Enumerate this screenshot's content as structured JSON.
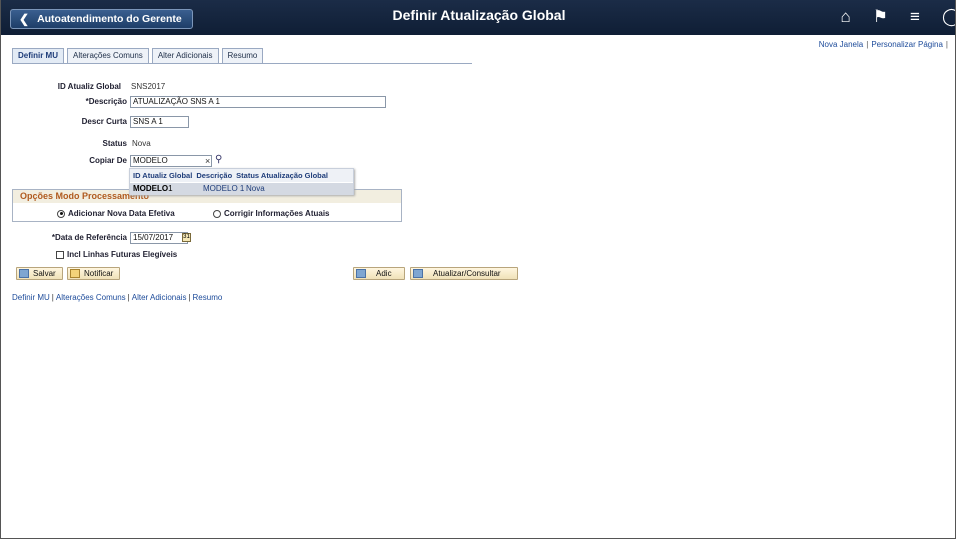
{
  "header": {
    "back_label": "Autoatendimento do Gerente",
    "title": "Definir Atualização Global",
    "icons": [
      "home-icon",
      "flag-icon",
      "menu-icon",
      "navbar-icon"
    ]
  },
  "toplinks": {
    "new_window": "Nova Janela",
    "personalize": "Personalizar Página"
  },
  "tabs": [
    "Definir MU",
    "Alterações Comuns",
    "Alter Adicionais",
    "Resumo"
  ],
  "form": {
    "id_label": "ID Atualiz Global",
    "id_value": "SNS2017",
    "descr_label": "*Descrição",
    "descr_value": "ATUALIZAÇÃO SNS A 1",
    "short_label": "Descr Curta",
    "short_value": "SNS A 1",
    "status_label": "Status",
    "status_value": "Nova",
    "copy_label": "Copiar De",
    "copy_value": "MODELO"
  },
  "dropdown": {
    "headers": [
      "ID Atualiz Global",
      "Descrição",
      "Status Atualização Global"
    ],
    "row": {
      "id": "MODELO1",
      "id_bold": "MODELO",
      "id_rest": "1",
      "descr": "MODELO 1",
      "status": "Nova"
    }
  },
  "process": {
    "title": "Opções Modo Processamento",
    "opt1": "Adicionar Nova Data Efetiva",
    "opt2": "Corrigir Informações Atuais",
    "selected": "opt1"
  },
  "ref_date": {
    "label": "*Data de Referência",
    "value": "15/07/2017"
  },
  "future": {
    "label": "Incl Linhas Futuras Elegíveis",
    "checked": false
  },
  "buttons": {
    "save": "Salvar",
    "notify": "Notificar",
    "add": "Adic",
    "update": "Atualizar/Consultar"
  },
  "bottom_links": [
    "Definir MU",
    "Alterações Comuns",
    "Alter Adicionais",
    "Resumo"
  ]
}
